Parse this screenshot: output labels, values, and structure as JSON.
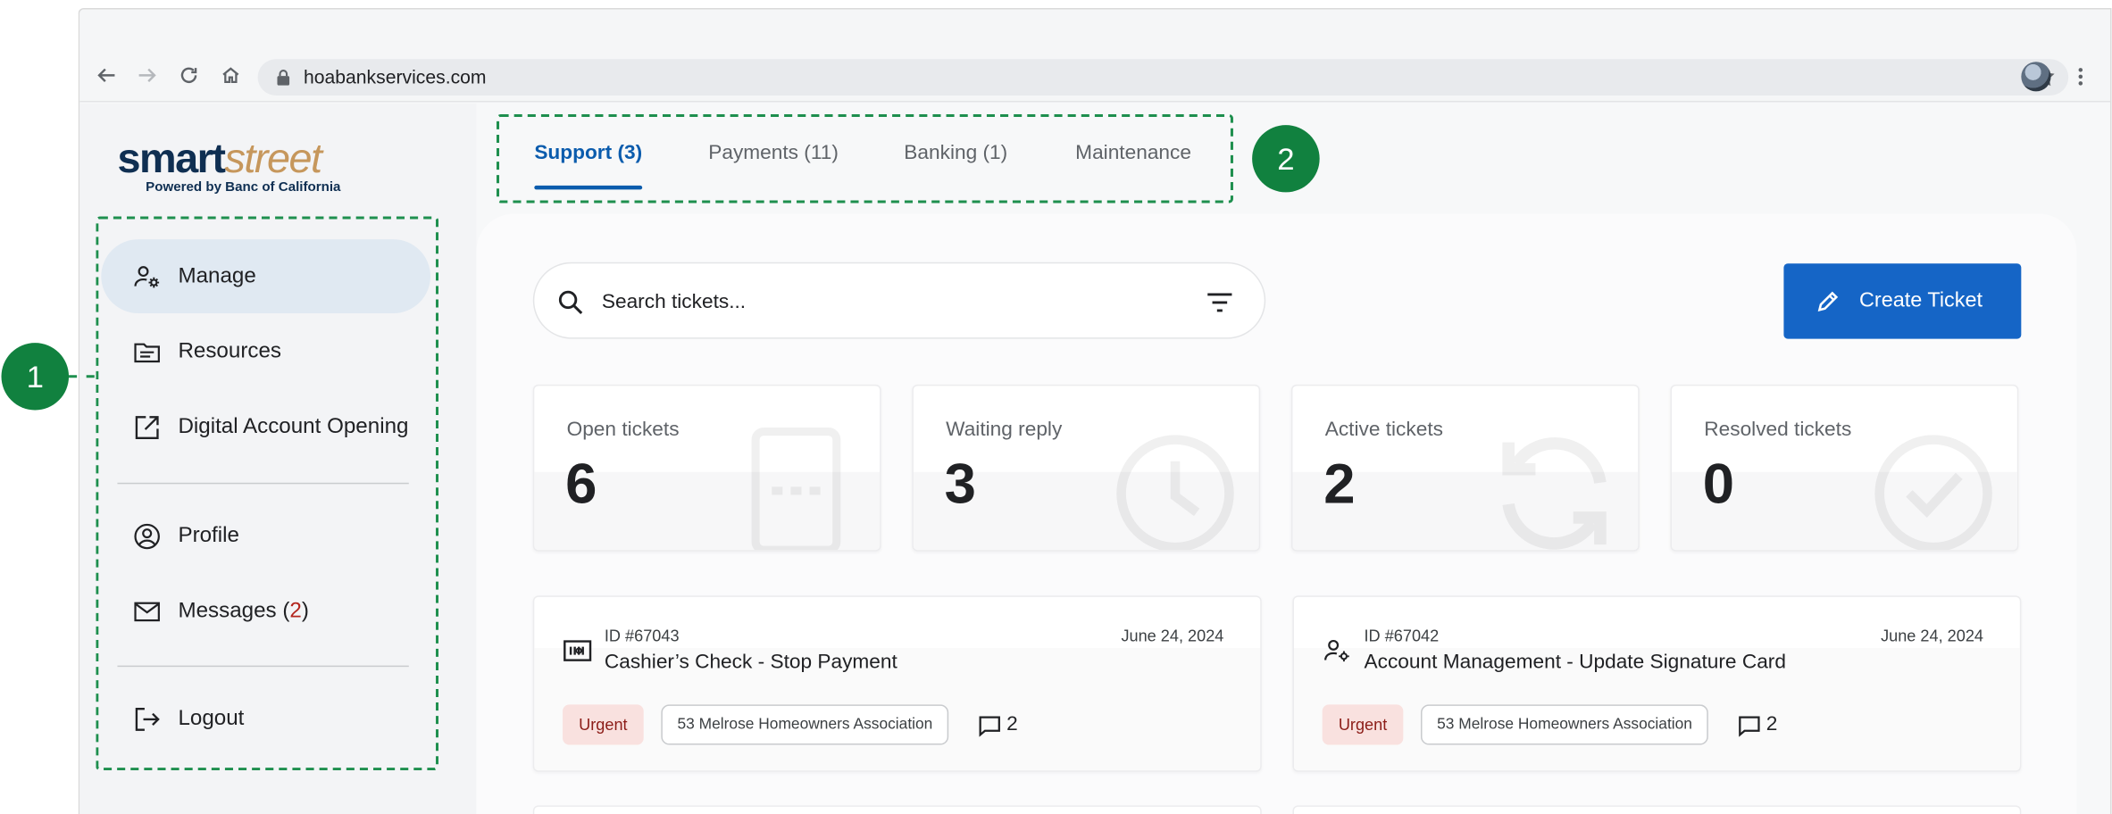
{
  "browser": {
    "url": "hoabankservices.com"
  },
  "logo": {
    "word_1": "smart",
    "word_2": "street",
    "tagline": "Powered by Banc of California"
  },
  "sidebar": {
    "items": [
      {
        "label": "Manage",
        "icon": "user-gear-icon",
        "active": true
      },
      {
        "label": "Resources",
        "icon": "folder-icon"
      },
      {
        "label": "Digital Account Opening",
        "icon": "external-link-icon"
      },
      {
        "label": "Profile",
        "icon": "user-circle-icon"
      },
      {
        "label": "Messages (",
        "icon": "mail-icon",
        "count": "2",
        "suffix": ")"
      },
      {
        "label": "Logout",
        "icon": "logout-icon"
      }
    ]
  },
  "tabs": [
    {
      "label": "Support (3)",
      "active": true
    },
    {
      "label": "Payments (11)"
    },
    {
      "label": "Banking (1)"
    },
    {
      "label": "Maintenance"
    }
  ],
  "search": {
    "placeholder": "Search tickets..."
  },
  "create_button": {
    "label": "Create Ticket"
  },
  "stats": [
    {
      "label": "Open tickets",
      "value": "6",
      "icon": "ticket-icon"
    },
    {
      "label": "Waiting reply",
      "value": "3",
      "icon": "clock-icon"
    },
    {
      "label": "Active tickets",
      "value": "2",
      "icon": "refresh-icon"
    },
    {
      "label": "Resolved tickets",
      "value": "0",
      "icon": "check-circle-icon"
    }
  ],
  "tickets": [
    {
      "id": "ID #67043",
      "date": "June 24, 2024",
      "title": "Cashier’s Check - Stop Payment",
      "priority": "Urgent",
      "association": "53 Melrose Homeowners Association",
      "comments": "2",
      "icon": "check-stub-icon"
    },
    {
      "id": "ID #67042",
      "date": "June 24, 2024",
      "title": "Account Management - Update Signature Card",
      "priority": "Urgent",
      "association": "53 Melrose Homeowners Association",
      "comments": "2",
      "icon": "user-gear-icon"
    }
  ],
  "annotations": {
    "badge_1": "1",
    "badge_2": "2"
  },
  "colors": {
    "primary": "#1565c6",
    "tab_active": "#0b5cad",
    "annotation_green": "#11813f",
    "urgent_bg": "#f9e1df",
    "urgent_text": "#8c1d18",
    "logo_navy": "#0f2f52",
    "logo_gold": "#c6975c"
  }
}
